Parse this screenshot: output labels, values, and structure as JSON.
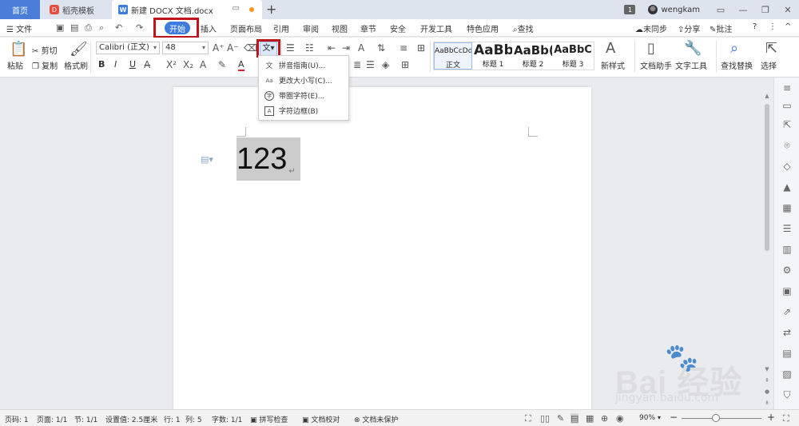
{
  "tabbar": {
    "home": "首页",
    "template_tab": "稻壳模板",
    "doc_tab": "新建 DOCX 文档.docx",
    "add": "+",
    "window_count": "1",
    "username": "wengkam",
    "controls": [
      "▭",
      "—",
      "❐",
      "✕"
    ]
  },
  "menu": {
    "file": "☰ 文件",
    "start": "开始",
    "items": [
      "插入",
      "页面布局",
      "引用",
      "审阅",
      "视图",
      "章节",
      "安全",
      "开发工具",
      "特色应用"
    ],
    "search": "查找",
    "sync": "未同步",
    "share": "分享",
    "comment": "批注",
    "help": "?"
  },
  "ribbon": {
    "paste": "粘贴",
    "cut": "剪切",
    "copy": "复制",
    "format_painter": "格式刷",
    "font_name": "Calibri (正文)",
    "font_size": "48",
    "bold": "B",
    "italic": "I",
    "underline": "U",
    "font_color_letter": "A",
    "phonetic_button": "文",
    "styles": [
      {
        "preview": "AaBbCcDd",
        "name": "正文"
      },
      {
        "preview": "AaBb",
        "name": "标题 1"
      },
      {
        "preview": "AaBb(",
        "name": "标题 2"
      },
      {
        "preview": "AaBbC",
        "name": "标题 3"
      }
    ],
    "new_style": "新样式",
    "doc_helper": "文档助手",
    "text_tools": "文字工具",
    "find_replace": "查找替换",
    "select": "选择"
  },
  "dropdown": {
    "items": [
      {
        "icon": "文",
        "label": "拼音指南(U)..."
      },
      {
        "icon": "Aa",
        "label": "更改大小写(C)..."
      },
      {
        "icon": "字",
        "label": "带圈字符(E)..."
      },
      {
        "icon": "A",
        "label": "字符边框(B)"
      }
    ]
  },
  "document": {
    "text": "123"
  },
  "status": {
    "page_num": "页码: 1",
    "pages": "页面: 1/1",
    "section": "节: 1/1",
    "setting": "设置值: 2.5厘米",
    "row": "行: 1",
    "col": "列: 5",
    "words": "字数: 1/1",
    "spell": "拼写检查",
    "proof": "文档校对",
    "protect": "文档未保护",
    "zoom": "90%",
    "zoom_minus": "−",
    "zoom_plus": "+"
  },
  "watermark": {
    "main": "Bai  经验",
    "sub": "jingyan.baidu.com"
  },
  "colors": {
    "accent": "#3d7be0",
    "highlight_box": "#c0141b",
    "home_tab": "#4a7ed8"
  }
}
